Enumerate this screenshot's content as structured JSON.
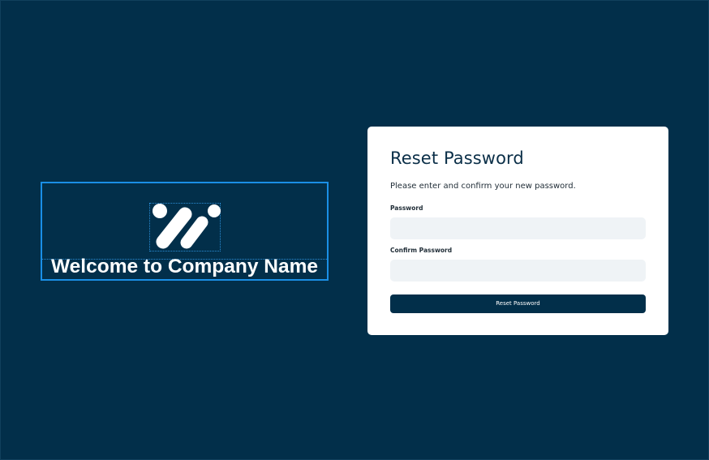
{
  "brand": {
    "logo_icon": "company-logo-icon",
    "welcome_text": "Welcome to Company Name"
  },
  "reset_form": {
    "title": "Reset Password",
    "description": "Please enter and confirm your new password.",
    "password_label": "Password",
    "password_value": "",
    "confirm_label": "Confirm Password",
    "confirm_value": "",
    "submit_label": "Reset Password"
  },
  "colors": {
    "background": "#022f4a",
    "card": "#ffffff",
    "input": "#eff3f6",
    "button": "#022f4a",
    "selection_outline": "#1a8fe6"
  }
}
